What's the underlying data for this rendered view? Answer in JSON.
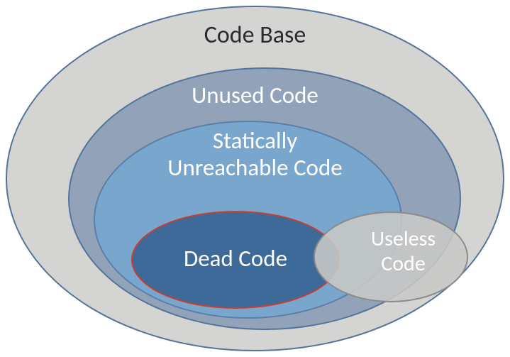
{
  "chart_data": {
    "type": "venn-nested",
    "sets": [
      {
        "id": "code_base",
        "label": "Code Base",
        "contains": [
          "unused_code"
        ],
        "fill": "#d4d4d3",
        "stroke": "#55739a"
      },
      {
        "id": "unused_code",
        "label": "Unused Code",
        "contains": [
          "statically_unreachable"
        ],
        "fill": "#91a2b9",
        "stroke": "#55739a"
      },
      {
        "id": "statically_unreachable",
        "label": "Statically\nUnreachable Code",
        "contains": [
          "dead_code"
        ],
        "fill": "#79a6cc",
        "stroke": "#5b7fa9"
      },
      {
        "id": "dead_code",
        "label": "Dead Code",
        "fill": "#3e6a9a",
        "stroke": "#d23b2f"
      },
      {
        "id": "useless_code",
        "label": "Useless\nCode",
        "overlaps": [
          "dead_code",
          "statically_unreachable",
          "unused_code",
          "code_base"
        ],
        "extends_outside": [
          "statically_unreachable",
          "unused_code"
        ],
        "fill": "rgba(200,200,198,0.88)",
        "stroke": "#8b8b8b"
      }
    ],
    "title": "",
    "notes": "Nested ellipses: Code Base ⊃ Unused Code ⊃ Statically Unreachable Code ⊃ Dead Code. 'Useless Code' ellipse overlaps Dead Code on the right and protrudes outside the Statically Unreachable / Unused regions."
  },
  "labels": {
    "code_base": "Code Base",
    "unused_code": "Unused Code",
    "statically_unreachable": "Statically\nUnreachable Code",
    "dead_code": "Dead Code",
    "useless_code": "Useless\nCode"
  }
}
